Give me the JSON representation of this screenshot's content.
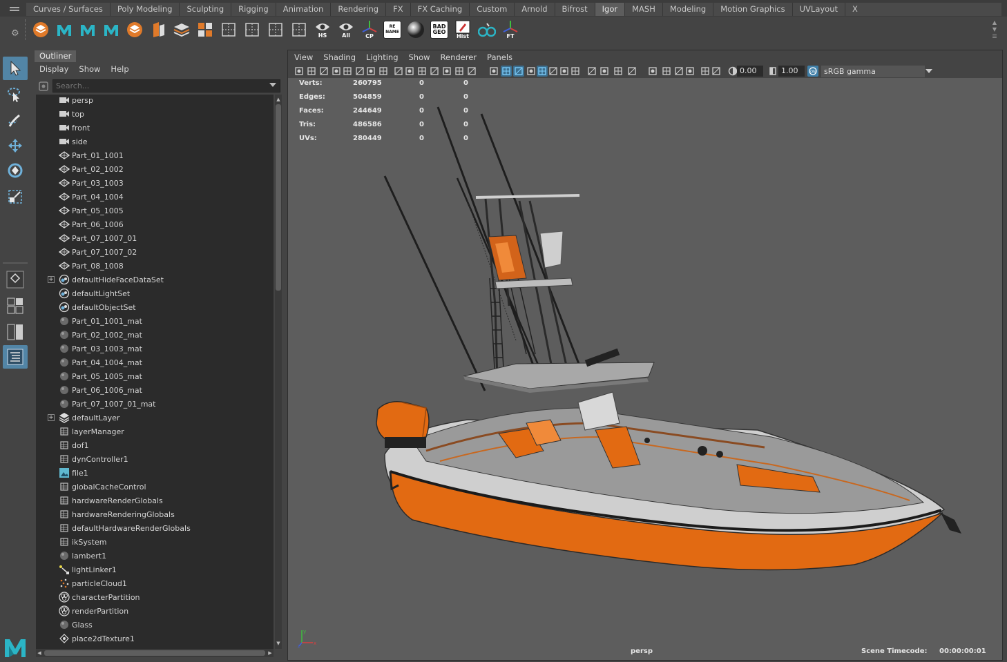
{
  "shelf": {
    "tabs": [
      {
        "label": "Curves / Surfaces",
        "active": false
      },
      {
        "label": "Poly Modeling",
        "active": false
      },
      {
        "label": "Sculpting",
        "active": false
      },
      {
        "label": "Rigging",
        "active": false
      },
      {
        "label": "Animation",
        "active": false
      },
      {
        "label": "Rendering",
        "active": false
      },
      {
        "label": "FX",
        "active": false
      },
      {
        "label": "FX Caching",
        "active": false
      },
      {
        "label": "Custom",
        "active": false
      },
      {
        "label": "Arnold",
        "active": false
      },
      {
        "label": "Bifrost",
        "active": false
      },
      {
        "label": "Igor",
        "active": true
      },
      {
        "label": "MASH",
        "active": false
      },
      {
        "label": "Modeling",
        "active": false
      },
      {
        "label": "Motion Graphics",
        "active": false
      },
      {
        "label": "UVLayout",
        "active": false
      },
      {
        "label": "XGen",
        "active": false
      }
    ],
    "icons": [
      {
        "name": "layers-icon",
        "label": "",
        "text": ""
      },
      {
        "name": "maya-m-icon",
        "label": "",
        "text": ""
      },
      {
        "name": "maya-m-icon",
        "label": "",
        "text": ""
      },
      {
        "name": "maya-m-icon",
        "label": "",
        "text": ""
      },
      {
        "name": "cube-icon",
        "label": "",
        "text": ""
      },
      {
        "name": "box-split-icon",
        "label": "",
        "text": ""
      },
      {
        "name": "stack-icon",
        "label": "",
        "text": ""
      },
      {
        "name": "grid-color-icon",
        "label": "",
        "text": ""
      },
      {
        "name": "grid-frame-icon",
        "label": "",
        "text": ""
      },
      {
        "name": "pen-icon",
        "label": "",
        "text": ""
      },
      {
        "name": "columns-icon",
        "label": "",
        "text": ""
      },
      {
        "name": "dashed-pen-icon",
        "label": "",
        "text": ""
      },
      {
        "name": "eye-icon",
        "label": "HS",
        "text": ""
      },
      {
        "name": "eye-icon",
        "label": "All",
        "text": ""
      },
      {
        "name": "axis-icon",
        "label": "CP",
        "text": ""
      },
      {
        "name": "rename-icon",
        "label": "",
        "text": "RE NAME"
      },
      {
        "name": "sphere-icon",
        "label": "",
        "text": ""
      },
      {
        "name": "bad-geo-icon",
        "label": "",
        "text": "BAD GEO"
      },
      {
        "name": "history-icon",
        "label": "Hist",
        "text": ""
      },
      {
        "name": "nodes-icon",
        "label": "",
        "text": ""
      },
      {
        "name": "axis-icon",
        "label": "FT",
        "text": ""
      }
    ]
  },
  "outliner": {
    "title": "Outliner",
    "menu": [
      "Display",
      "Show",
      "Help"
    ],
    "search_placeholder": "Search...",
    "items": [
      {
        "label": "persp",
        "icon": "camera-icon",
        "expandable": false
      },
      {
        "label": "top",
        "icon": "camera-icon",
        "expandable": false
      },
      {
        "label": "front",
        "icon": "camera-icon",
        "expandable": false
      },
      {
        "label": "side",
        "icon": "camera-icon",
        "expandable": false
      },
      {
        "label": "Part_01_1001",
        "icon": "mesh-icon",
        "expandable": false
      },
      {
        "label": "Part_02_1002",
        "icon": "mesh-icon",
        "expandable": false
      },
      {
        "label": "Part_03_1003",
        "icon": "mesh-icon",
        "expandable": false
      },
      {
        "label": "Part_04_1004",
        "icon": "mesh-icon",
        "expandable": false
      },
      {
        "label": "Part_05_1005",
        "icon": "mesh-icon",
        "expandable": false
      },
      {
        "label": "Part_06_1006",
        "icon": "mesh-icon",
        "expandable": false
      },
      {
        "label": "Part_07_1007_01",
        "icon": "mesh-icon",
        "expandable": false
      },
      {
        "label": "Part_07_1007_02",
        "icon": "mesh-icon",
        "expandable": false
      },
      {
        "label": "Part_08_1008",
        "icon": "mesh-icon",
        "expandable": false
      },
      {
        "label": "defaultHideFaceDataSet",
        "icon": "set-icon",
        "expandable": true
      },
      {
        "label": "defaultLightSet",
        "icon": "set-icon",
        "expandable": false
      },
      {
        "label": "defaultObjectSet",
        "icon": "set-icon",
        "expandable": false
      },
      {
        "label": "Part_01_1001_mat",
        "icon": "material-sphere-icon",
        "expandable": false
      },
      {
        "label": "Part_02_1002_mat",
        "icon": "material-sphere-icon",
        "expandable": false
      },
      {
        "label": "Part_03_1003_mat",
        "icon": "material-sphere-icon",
        "expandable": false
      },
      {
        "label": "Part_04_1004_mat",
        "icon": "material-sphere-icon",
        "expandable": false
      },
      {
        "label": "Part_05_1005_mat",
        "icon": "material-sphere-icon",
        "expandable": false
      },
      {
        "label": "Part_06_1006_mat",
        "icon": "material-sphere-icon",
        "expandable": false
      },
      {
        "label": "Part_07_1007_01_mat",
        "icon": "material-sphere-icon",
        "expandable": false
      },
      {
        "label": "defaultLayer",
        "icon": "layer-icon",
        "expandable": true
      },
      {
        "label": "layerManager",
        "icon": "node-icon",
        "expandable": false
      },
      {
        "label": "dof1",
        "icon": "node-icon",
        "expandable": false
      },
      {
        "label": "dynController1",
        "icon": "node-icon",
        "expandable": false
      },
      {
        "label": "file1",
        "icon": "file-texture-icon",
        "expandable": false
      },
      {
        "label": "globalCacheControl",
        "icon": "node-icon",
        "expandable": false
      },
      {
        "label": "hardwareRenderGlobals",
        "icon": "node-icon",
        "expandable": false
      },
      {
        "label": "hardwareRenderingGlobals",
        "icon": "node-icon",
        "expandable": false
      },
      {
        "label": "defaultHardwareRenderGlobals",
        "icon": "node-icon",
        "expandable": false
      },
      {
        "label": "ikSystem",
        "icon": "node-icon",
        "expandable": false
      },
      {
        "label": "lambert1",
        "icon": "material-sphere-icon",
        "expandable": false
      },
      {
        "label": "lightLinker1",
        "icon": "light-linker-icon",
        "expandable": false
      },
      {
        "label": "particleCloud1",
        "icon": "particle-icon",
        "expandable": false
      },
      {
        "label": "characterPartition",
        "icon": "partition-icon",
        "expandable": false
      },
      {
        "label": "renderPartition",
        "icon": "partition-icon",
        "expandable": false
      },
      {
        "label": "Glass",
        "icon": "material-sphere-icon",
        "expandable": false
      },
      {
        "label": "place2dTexture1",
        "icon": "place2d-icon",
        "expandable": false
      }
    ]
  },
  "viewport": {
    "menu": [
      "View",
      "Shading",
      "Lighting",
      "Show",
      "Renderer",
      "Panels"
    ],
    "exposure": "0.00",
    "gamma": "1.00",
    "color_space": "sRGB gamma",
    "hud": {
      "rows": [
        {
          "label": "Verts:",
          "v1": "260795",
          "v2": "0",
          "v3": "0"
        },
        {
          "label": "Edges:",
          "v1": "504859",
          "v2": "0",
          "v3": "0"
        },
        {
          "label": "Faces:",
          "v1": "244649",
          "v2": "0",
          "v3": "0"
        },
        {
          "label": "Tris:",
          "v1": "486586",
          "v2": "0",
          "v3": "0"
        },
        {
          "label": "UVs:",
          "v1": "280449",
          "v2": "0",
          "v3": "0"
        }
      ],
      "camera": "persp",
      "timecode_label": "Scene Timecode:",
      "timecode_value": "00:00:00:01"
    }
  },
  "colors": {
    "hull": "#e26a12",
    "accent_selection": "#5285a6",
    "viewport_bg": "#5d5d5d"
  }
}
